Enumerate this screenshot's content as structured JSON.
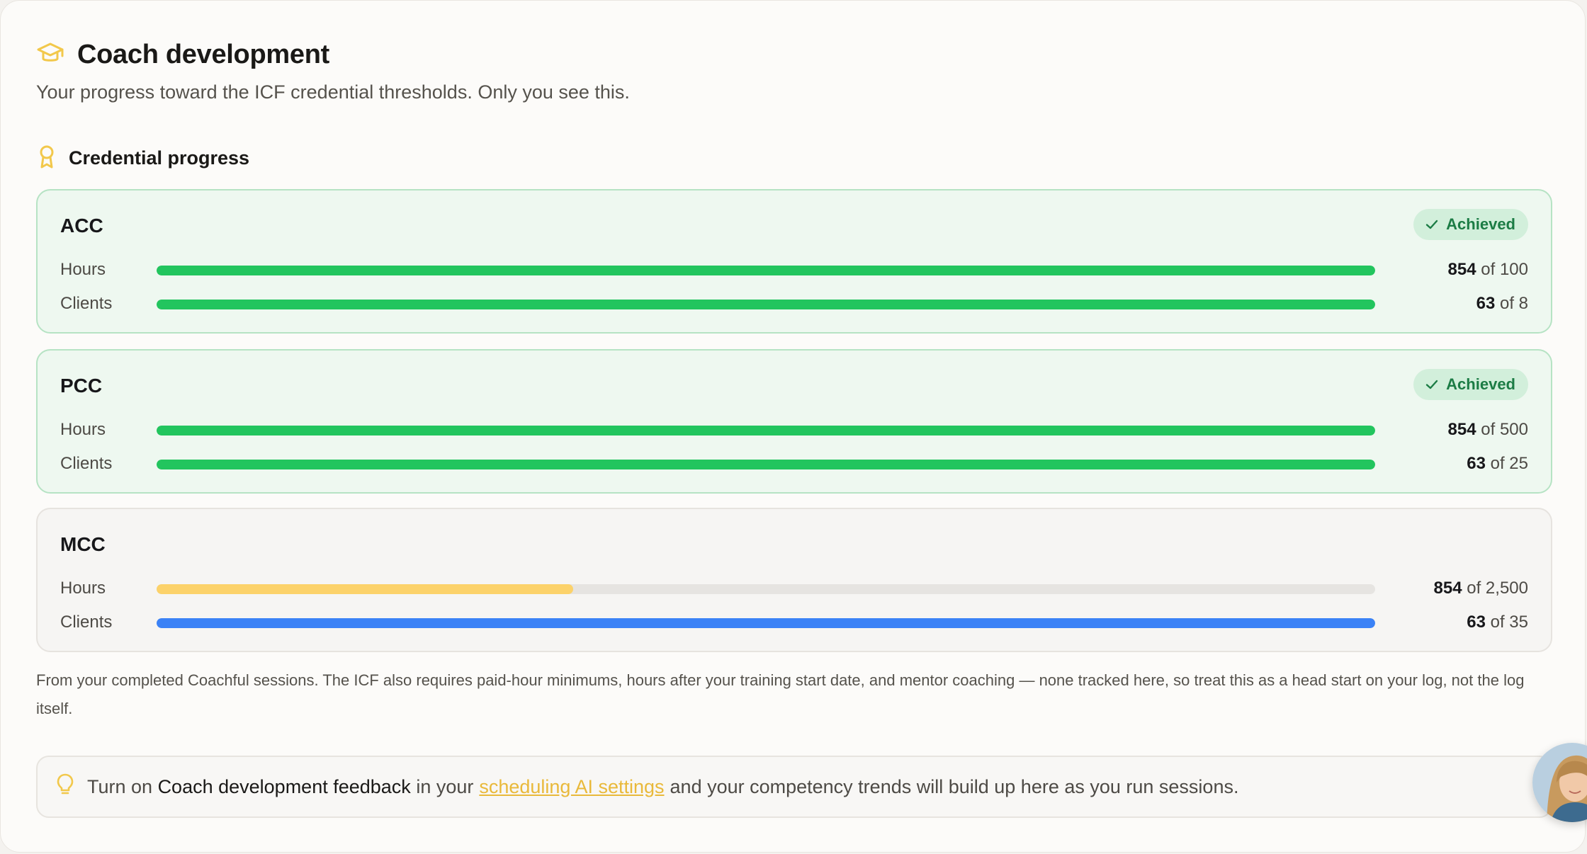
{
  "header": {
    "icon": "graduation-cap-icon",
    "title": "Coach development",
    "subtitle": "Your progress toward the ICF credential thresholds. Only you see this."
  },
  "section": {
    "icon": "award-ribbon-icon",
    "title": "Credential progress"
  },
  "colors": {
    "accent_yellow": "#f5c94a",
    "success_green": "#22c55e",
    "info_blue": "#3b82f6",
    "track_gray": "#e6e4e1"
  },
  "credentials": [
    {
      "name": "ACC",
      "achieved": true,
      "badge": "Achieved",
      "rows": [
        {
          "label": "Hours",
          "value": "854",
          "target": "of 100",
          "progress": 1.0,
          "color": "#22c55e"
        },
        {
          "label": "Clients",
          "value": "63",
          "target": "of 8",
          "progress": 1.0,
          "color": "#22c55e"
        }
      ]
    },
    {
      "name": "PCC",
      "achieved": true,
      "badge": "Achieved",
      "rows": [
        {
          "label": "Hours",
          "value": "854",
          "target": "of 500",
          "progress": 1.0,
          "color": "#22c55e"
        },
        {
          "label": "Clients",
          "value": "63",
          "target": "of 25",
          "progress": 1.0,
          "color": "#22c55e"
        }
      ]
    },
    {
      "name": "MCC",
      "achieved": false,
      "badge": "",
      "rows": [
        {
          "label": "Hours",
          "value": "854",
          "target": "of 2,500",
          "progress": 0.3416,
          "color": "#fcd26a"
        },
        {
          "label": "Clients",
          "value": "63",
          "target": "of 35",
          "progress": 1.0,
          "color": "#3b82f6"
        }
      ]
    }
  ],
  "note": "From your completed Coachful sessions. The ICF also requires paid-hour minimums, hours after your training start date, and mentor coaching — none tracked here, so treat this as a head start on your log, not the log itself.",
  "callout": {
    "icon": "lightbulb-icon",
    "part1": "Turn on ",
    "strong": "Coach development feedback",
    "part2": " in your",
    "link": "scheduling AI settings",
    "part3": "and your competency trends will build up here as you run sessions."
  },
  "avatar": {
    "alt": "User avatar"
  }
}
